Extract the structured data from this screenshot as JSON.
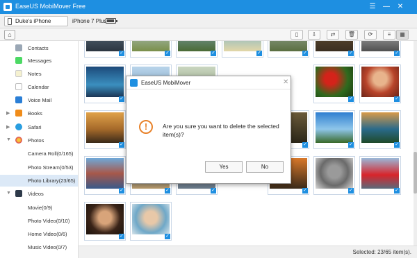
{
  "window": {
    "title": "EaseUS MobiMover Free"
  },
  "device": {
    "name": "Duke's iPhone",
    "model": "iPhone 7 Plus"
  },
  "toolbar": {
    "buttons": [
      "import-icon",
      "export-icon",
      "transfer-icon",
      "delete-icon",
      "refresh-icon",
      "list-view-icon",
      "grid-view-icon"
    ]
  },
  "sidebar": {
    "items": [
      {
        "label": "Contacts",
        "icon": "contacts-icon"
      },
      {
        "label": "Messages",
        "icon": "messages-icon"
      },
      {
        "label": "Notes",
        "icon": "notes-icon"
      },
      {
        "label": "Calendar",
        "icon": "calendar-icon"
      },
      {
        "label": "Voice Mail",
        "icon": "voicemail-icon"
      },
      {
        "label": "Books",
        "icon": "books-icon"
      },
      {
        "label": "Safari",
        "icon": "safari-icon"
      },
      {
        "label": "Photos",
        "icon": "photos-icon"
      },
      {
        "label": "Camera Roll(0/165)"
      },
      {
        "label": "Photo Stream(0/53)"
      },
      {
        "label": "Photo Library(23/65)"
      },
      {
        "label": "Videos",
        "icon": "videos-icon"
      },
      {
        "label": "Movie(0/9)"
      },
      {
        "label": "Photo Video(0/10)"
      },
      {
        "label": "Home Video(0/6)"
      },
      {
        "label": "Music Video(0/7)"
      }
    ]
  },
  "status": {
    "text": "Selected: 23/65 item(s)."
  },
  "dialog": {
    "title": "EaseUS MobiMover",
    "message": "Are you sure you want to delete the selected item(s)?",
    "yes_label": "Yes",
    "no_label": "No"
  },
  "colors": {
    "accent": "#1e8fe1",
    "warning": "#e8822a",
    "selected_row": "#dce9f7"
  }
}
